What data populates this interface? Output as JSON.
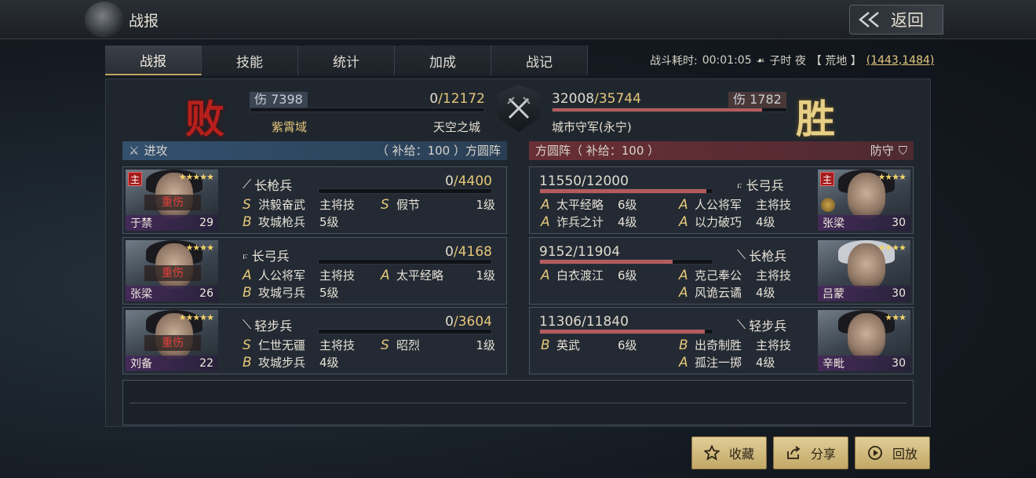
{
  "app": {
    "title": "战报",
    "back_label": "返回"
  },
  "tabs": [
    {
      "label": "战报",
      "active": true
    },
    {
      "label": "技能"
    },
    {
      "label": "统计"
    },
    {
      "label": "加成"
    },
    {
      "label": "战记"
    }
  ],
  "battle_info": {
    "duration_label": "战斗耗时:",
    "duration": "00:01:05",
    "time_of_day": "子时 夜",
    "terrain": "【 荒地 】",
    "coords": "(1443,1484)"
  },
  "summary": {
    "left": {
      "result": "败",
      "damage_label": "伤 7398",
      "hp_current": "0",
      "hp_max": "/12172",
      "hp_fraction": 0.0,
      "army_a": "紫霄域",
      "army_b": "天空之城"
    },
    "right": {
      "result": "胜",
      "damage_label": "伤 1782",
      "hp_current": "32008",
      "hp_max": "/35744",
      "hp_fraction": 0.895,
      "army": "城市守军(永宁)"
    }
  },
  "sides": {
    "left": {
      "label": "进攻",
      "supply": "（ 补给：100 ）方圆阵"
    },
    "right": {
      "label": "方圆阵（ 补给：100 ）",
      "role": "防守"
    }
  },
  "left_units": [
    {
      "name": "于禁",
      "level": "29",
      "stars": "★★★★★",
      "lord": "主",
      "status": "重伤",
      "unit_type": "长枪兵",
      "troops_current": "0",
      "troops_max": "/4400",
      "troops_fraction": 0.0,
      "skills": [
        {
          "grade": "S",
          "name": "洪毅奋武",
          "level": "主将技"
        },
        {
          "grade": "S",
          "name": "假节",
          "level": "1级"
        },
        {
          "grade": "B",
          "name": "攻城枪兵",
          "level": "5级"
        }
      ]
    },
    {
      "name": "张梁",
      "level": "26",
      "stars": "★★★★",
      "lord": "",
      "status": "重伤",
      "unit_type": "长弓兵",
      "troops_current": "0",
      "troops_max": "/4168",
      "troops_fraction": 0.0,
      "skills": [
        {
          "grade": "A",
          "name": "人公将军",
          "level": "主将技"
        },
        {
          "grade": "A",
          "name": "太平经略",
          "level": "1级"
        },
        {
          "grade": "B",
          "name": "攻城弓兵",
          "level": "5级"
        }
      ]
    },
    {
      "name": "刘备",
      "level": "22",
      "stars": "★★★★★",
      "lord": "",
      "status": "重伤",
      "unit_type": "轻步兵",
      "troops_current": "0",
      "troops_max": "/3604",
      "troops_fraction": 0.0,
      "skills": [
        {
          "grade": "S",
          "name": "仁世无疆",
          "level": "主将技"
        },
        {
          "grade": "S",
          "name": "昭烈",
          "level": "1级"
        },
        {
          "grade": "B",
          "name": "攻城步兵",
          "level": "4级"
        }
      ]
    }
  ],
  "right_units": [
    {
      "name": "张梁",
      "level": "30",
      "stars": "★★★★",
      "lord": "主",
      "status": "",
      "unit_type": "长弓兵",
      "troops_current": "11550",
      "troops_max": "/12000",
      "troops_fraction": 0.9625,
      "skills": [
        {
          "grade": "A",
          "name": "太平经略",
          "level": "6级"
        },
        {
          "grade": "A",
          "name": "人公将军",
          "level": "主将技"
        },
        {
          "grade": "A",
          "name": "诈兵之计",
          "level": "4级"
        },
        {
          "grade": "A",
          "name": "以力破巧",
          "level": "4级"
        }
      ]
    },
    {
      "name": "吕蒙",
      "level": "30",
      "stars": "★★★★",
      "lord": "",
      "status": "",
      "unit_type": "长枪兵",
      "troops_current": "9152",
      "troops_max": "/11904",
      "troops_fraction": 0.769,
      "skills": [
        {
          "grade": "A",
          "name": "白衣渡江",
          "level": "6级"
        },
        {
          "grade": "A",
          "name": "克己奉公",
          "level": "主将技"
        },
        {
          "grade": "",
          "name": "",
          "level": ""
        },
        {
          "grade": "A",
          "name": "风诡云谲",
          "level": "4级"
        }
      ]
    },
    {
      "name": "辛毗",
      "level": "30",
      "stars": "★★★",
      "lord": "",
      "status": "",
      "unit_type": "轻步兵",
      "troops_current": "11306",
      "troops_max": "/11840",
      "troops_fraction": 0.955,
      "skills": [
        {
          "grade": "B",
          "name": "英武",
          "level": "6级"
        },
        {
          "grade": "B",
          "name": "出奇制胜",
          "level": "主将技"
        },
        {
          "grade": "",
          "name": "",
          "level": ""
        },
        {
          "grade": "A",
          "name": "孤注一掷",
          "level": "4级"
        }
      ]
    }
  ],
  "buttons": {
    "favorite": "收藏",
    "share": "分享",
    "replay": "回放"
  }
}
